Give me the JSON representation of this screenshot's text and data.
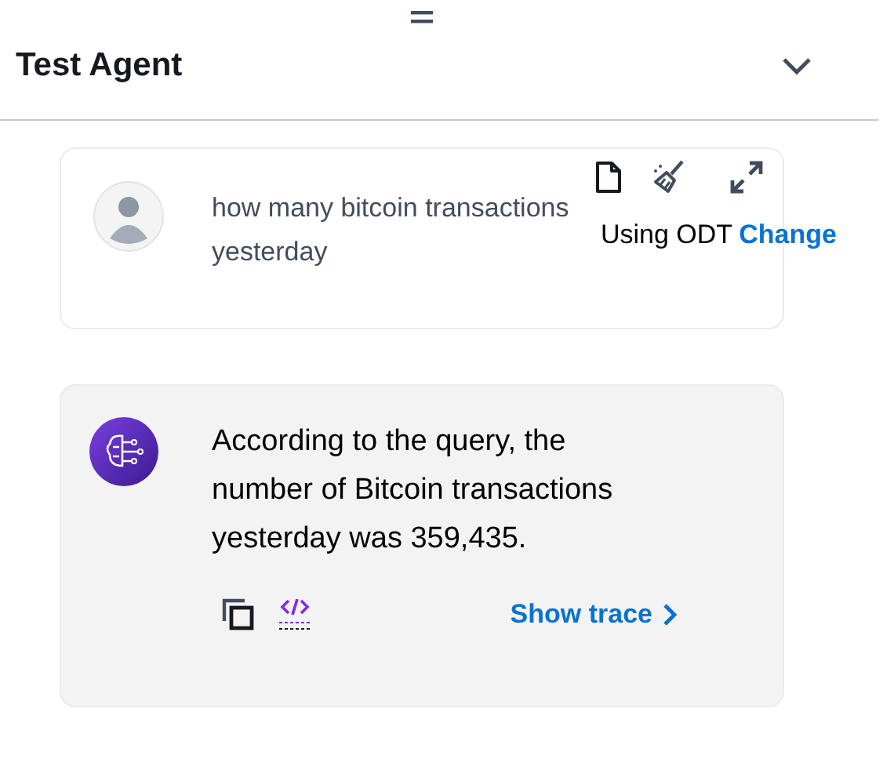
{
  "header": {
    "title": "Test Agent"
  },
  "user_message": {
    "text": "how many bitcoin transactions yesterday",
    "status": "Using ODT",
    "status_link": "Change"
  },
  "agent_message": {
    "text": "According to the query, the number of Bitcoin transactions yesterday was 359,435.",
    "trace_link": "Show trace"
  }
}
